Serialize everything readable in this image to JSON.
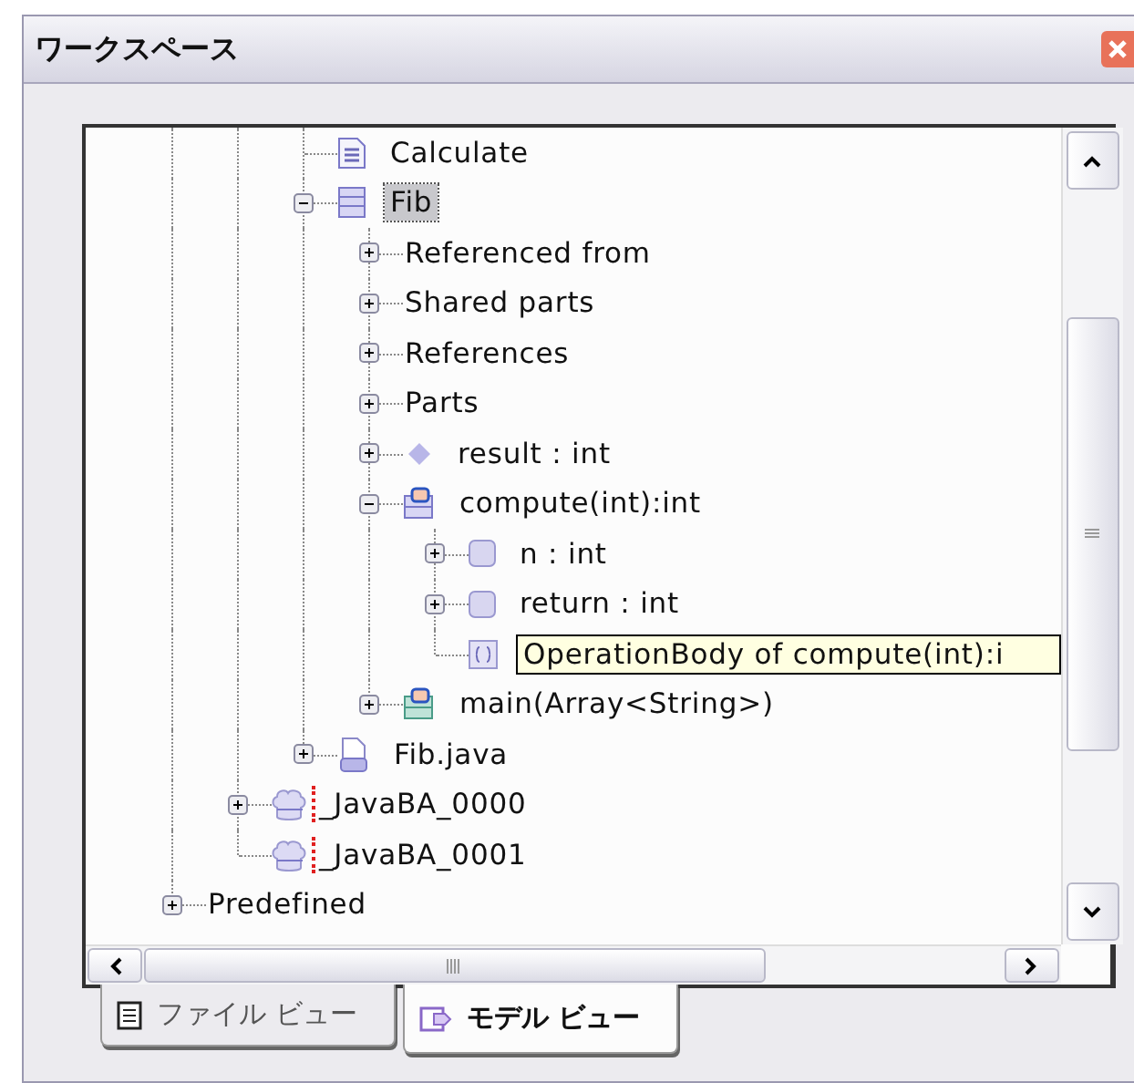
{
  "window": {
    "title": "ワークスペース"
  },
  "tree": {
    "children": [
      {
        "children": [
          {
            "children": [
              {
                "label": "Calculate",
                "kind": "document",
                "selected": false,
                "hovered": false,
                "flagged": false
              },
              {
                "label": "Fib",
                "kind": "class",
                "expanded": true,
                "selected": true,
                "hovered": false,
                "flagged": false,
                "children": [
                  {
                    "label": "Referenced from",
                    "kind": "group",
                    "expanded": false,
                    "selected": false,
                    "hovered": false,
                    "flagged": false
                  },
                  {
                    "label": "Shared parts",
                    "kind": "group",
                    "expanded": false,
                    "selected": false,
                    "hovered": false,
                    "flagged": false
                  },
                  {
                    "label": "References",
                    "kind": "group",
                    "expanded": false,
                    "selected": false,
                    "hovered": false,
                    "flagged": false
                  },
                  {
                    "label": "Parts",
                    "kind": "group",
                    "expanded": false,
                    "selected": false,
                    "hovered": false,
                    "flagged": false
                  },
                  {
                    "label": "result : int",
                    "kind": "attribute",
                    "expanded": false,
                    "selected": false,
                    "hovered": false,
                    "flagged": false
                  },
                  {
                    "label": "compute(int):int",
                    "kind": "operation",
                    "expanded": true,
                    "selected": false,
                    "hovered": false,
                    "flagged": false,
                    "children": [
                      {
                        "label": "n : int",
                        "kind": "parameter",
                        "expanded": false,
                        "selected": false,
                        "hovered": false,
                        "flagged": false
                      },
                      {
                        "label": "return  : int",
                        "kind": "parameter",
                        "expanded": false,
                        "selected": false,
                        "hovered": false,
                        "flagged": false
                      },
                      {
                        "label": "OperationBody of compute(int):i",
                        "kind": "body",
                        "selected": false,
                        "hovered": true,
                        "flagged": false
                      }
                    ]
                  },
                  {
                    "label": "main(Array<String>)",
                    "kind": "main",
                    "expanded": false,
                    "selected": false,
                    "hovered": false,
                    "flagged": false
                  }
                ]
              },
              {
                "label": "Fib.java",
                "kind": "file",
                "expanded": false,
                "selected": false,
                "hovered": false,
                "flagged": false
              }
            ]
          },
          {
            "label": "_JavaBA_0000",
            "kind": "package",
            "expanded": false,
            "selected": false,
            "hovered": false,
            "flagged": true
          },
          {
            "label": "_JavaBA_0001",
            "kind": "package",
            "selected": false,
            "hovered": false,
            "flagged": true
          }
        ]
      },
      {
        "label": "Predefined",
        "kind": "group",
        "expanded": false,
        "selected": false,
        "hovered": false,
        "flagged": false
      }
    ]
  },
  "tabs": [
    {
      "label": "ファイル ビュー",
      "selected": false,
      "kind": "file"
    },
    {
      "label": "モデル ビュー",
      "selected": true,
      "kind": "model"
    }
  ]
}
